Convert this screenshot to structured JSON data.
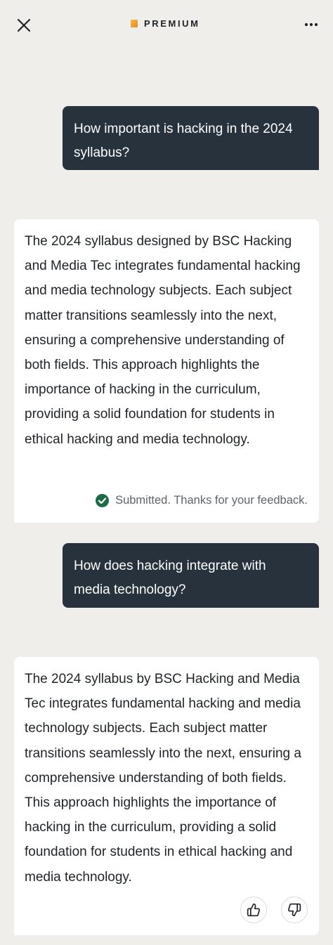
{
  "header": {
    "close_icon": "close-icon",
    "premium_label": "PREMIUM",
    "premium_color": "#f2a33a",
    "more_icon": "more-horizontal-icon"
  },
  "messages": [
    {
      "role": "user",
      "text": "How important is hacking in the 2024 syllabus?"
    },
    {
      "role": "assistant",
      "text": "The 2024 syllabus designed by BSC Hacking and Media Tec integrates fundamental hacking and media technology subjects. Each subject matter transitions seamlessly into the next, ensuring a comprehensive understanding of both fields. This approach highlights the importance of hacking in the curriculum, providing a solid foundation for students in ethical hacking and media technology.",
      "feedback_text": "Submitted. Thanks for your feedback.",
      "feedback_icon": "check-circle-icon",
      "feedback_color": "#1d6b46"
    },
    {
      "role": "user",
      "text": "How does hacking integrate with media technology?"
    },
    {
      "role": "assistant",
      "text": "The 2024 syllabus by BSC Hacking and Media Tec integrates fundamental hacking and media technology subjects. Each subject matter transitions seamlessly into the next, ensuring a comprehensive understanding of both fields. This approach highlights the importance of hacking in the curriculum, providing a solid foundation for students in ethical hacking and media technology.",
      "rating_icons": [
        "thumbs-up-icon",
        "thumbs-down-icon"
      ]
    }
  ],
  "colors": {
    "background": "#f0eeea",
    "user_bubble": "#28323d",
    "card": "#ffffff"
  }
}
